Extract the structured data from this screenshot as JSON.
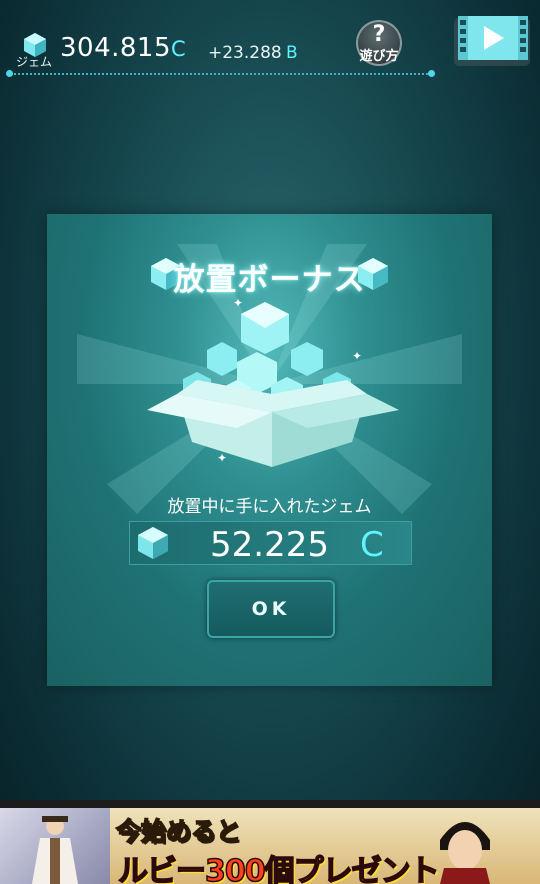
{
  "header": {
    "gem_label": "ジェム",
    "gem_value": "304.815",
    "gem_unit": "C",
    "gem_rate": "+23.288",
    "gem_rate_unit": "B",
    "help_icon": "?",
    "help_label": "遊び方",
    "video_icon": "play-video-icon"
  },
  "dialog": {
    "title": "放置ボーナス",
    "earned_label": "放置中に手に入れたジェム",
    "amount_value": "52.225",
    "amount_unit": "C",
    "ok_label": "OK"
  },
  "ad": {
    "line1": "今始めると",
    "line2": "ルビー300個プレゼント"
  },
  "colors": {
    "accent_cyan": "#5ff3ff",
    "dialog_teal": "#2f8f90",
    "background_dark": "#0b2c33"
  }
}
